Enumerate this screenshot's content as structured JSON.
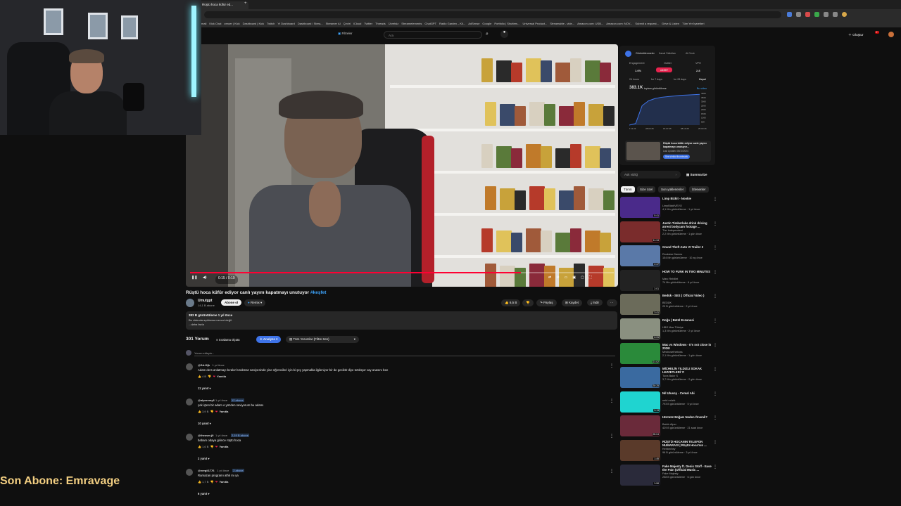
{
  "browser": {
    "tab_title": "Rüştü hoca küfür ed...",
    "new_tab": "+"
  },
  "bookmarks": [
    "mail",
    "Kick Chat",
    "zeroer | Kick",
    "Dashboard | Kick",
    "Twitch",
    "Yt Dashboard",
    "Dashboard / Strea...",
    "Streamer AI",
    "Çeviri",
    "iCloud",
    "Twitter",
    "Threads",
    "Ücretsiz",
    "Streamelements",
    "ChatGPT",
    "Radio Garden – Kli...",
    "AdSense",
    "Google",
    "Portfolio | Shutters...",
    "Universal Product...",
    "Streamable - vide...",
    "Amazon.com: USB...",
    "Amazon.com: NOV...",
    "Submit a request...",
    "Grive & Listen",
    "Tüm Yer İşaretleri"
  ],
  "youtube": {
    "filters": "Filtreler",
    "search_placeholder": "Ara",
    "create": "Oluştur",
    "notif_count": "9+"
  },
  "video": {
    "time": "0:15 / 0:19",
    "progress": 0.78,
    "title": "Rüştü hoca küfür ediyor canlı yayını kapatmayı unutuyor",
    "hashtag": "#keşfet"
  },
  "channel": {
    "name": "Umutgpt",
    "subs": "14,1 B abone",
    "subscribe": "Abone ol",
    "remix": "Remix"
  },
  "actions": {
    "likes": "6,5 B",
    "share": "Paylaş",
    "save": "Kaydet",
    "download": "İndir"
  },
  "description": {
    "stats": "383 B görüntüleme  1 yıl önce",
    "line": "Bu videoda açıklama mevcut değil.",
    "more": "...daha fazla"
  },
  "comments_header": {
    "count": "301 Yorum",
    "sort": "Sıralama ölçütü",
    "analyze": "Analyze",
    "filter": "Tüm Yorumlar (Filtre Ses)",
    "add": "Yorum ekleyin..."
  },
  "comments": [
    {
      "user": "@Sd-f2jk",
      "time": "1 yıl önce",
      "text": "Adam ders anlatmayı bırakır bırakmaz saniyesinde yine öğrencileri için bi şey yapmakla ilgileniyor bir de geciktir diye üzülüyor vay anasını bee",
      "likes": "4 B",
      "reply": "Yanıtla",
      "replies": "11 yanıt"
    },
    {
      "user": "@alperemy6",
      "time": "1 yıl önce",
      "badge": "12 abone",
      "text": "çok içten bir adam o yüzden seviyorum bu adamı",
      "likes": "3,9 B",
      "reply": "Yanıtla",
      "replies": "10 yanıt"
    },
    {
      "user": "@theown.j9",
      "time": "1 yıl önce",
      "badge": "2,19 B abone",
      "text": "babam odaya girince rüştü hoca",
      "likes": "1,6 B",
      "reply": "Yanıtla",
      "replies": "2 yanıt"
    },
    {
      "user": "@vergil1776",
      "time": "1 yıl önce",
      "badge": "2 abone",
      "text": "Ramazan programı athk mı ya",
      "likes": "1,7 B",
      "reply": "Yanıtla",
      "replies": "6 yanıt"
    }
  ],
  "stats_panel": {
    "tabs": [
      "Görüntülenmeler",
      "Kanal Sıklıkları",
      "AI Cevir"
    ],
    "metrics": [
      {
        "label": "Engagement",
        "value": "1.6%"
      },
      {
        "label": "Outlier",
        "value": "x100+"
      },
      {
        "label": "VPH",
        "value": "2.8"
      }
    ],
    "ranges": [
      "24 hours",
      "for 7 days",
      "for 28 days",
      "Hepsi"
    ],
    "views": "383.1K",
    "views_label": "toplam görüntüleme",
    "this_video": "Bu video",
    "yticks": [
      "400K",
      "350K",
      "300K",
      "250K",
      "200K",
      "150K",
      "100K",
      "50K"
    ],
    "xticks": [
      "07.11.24",
      "28.03.25",
      "15.07.25",
      "08.10.25",
      "25.03.26"
    ],
    "growth": [
      0,
      5,
      60,
      75,
      82,
      86,
      88,
      90,
      92,
      93,
      94,
      95
    ],
    "card_title": "Rüştü hoca küfür ediyor canlı yayını kapatmayı unutuyor...",
    "card_sub": "Last Updated 05/10/2024",
    "card_btn": "See similar thumbnails"
  },
  "ask": {
    "placeholder": "Ask vidIQ",
    "summarize": "Summarize"
  },
  "chips": [
    "Tümü",
    "Size özel",
    "Son yüklenenler",
    "İzlenenler"
  ],
  "recs": [
    {
      "title": "Limp Bizkit - Nookie",
      "ch": "LimpBizkitVEVO",
      "meta": "4,1 Mn görüntüleme · 1 yıl önce",
      "dur": "5:41",
      "color": "#4a2a8a"
    },
    {
      "title": "Justin Timberlake drink driving arrest bodycam footage ...",
      "ch": "The Independent",
      "meta": "2,2 Mn görüntüleme · 1 gün önce",
      "dur": "11:34",
      "color": "#7a2c2c"
    },
    {
      "title": "Grand Theft Auto VI Trailer 2",
      "ch": "Rockstar Games",
      "meta": "154 Mn görüntüleme · 10 ay önce",
      "dur": "2:47",
      "color": "#5a79a8"
    },
    {
      "title": "HOW TO FUNK IN TWO MINUTES",
      "ch": "Marc Rebillet",
      "meta": "74 Mn görüntüleme · 6 yıl önce",
      "dur": "2:01",
      "color": "#222"
    },
    {
      "title": "Bedük - SES ( Official Video )",
      "ch": "BEDÜK",
      "meta": "29 B görüntüleme · 2 yıl önce",
      "dur": "3:41",
      "color": "#6b6b5a"
    },
    {
      "title": "Doğu | Betül Eczanesi",
      "ch": "HBO Max Türkiye",
      "meta": "1,3 Mn görüntüleme · 2 yıl önce",
      "dur": "0:31",
      "color": "#8a9080"
    },
    {
      "title": "Mac vs Windows - It's not close in 2026!",
      "ch": "Mrwhosetheboss",
      "meta": "2,1 Mn görüntüleme · 1 gün önce",
      "dur": "21:02",
      "color": "#2a8a3a"
    },
    {
      "title": "MİCHELİN YILDIZLI SOKAK LEZZETLERİ ?!",
      "ch": "Tuna Bakır S",
      "meta": "3,7 Mn görüntüleme · 2 gün önce",
      "dur": "30:25",
      "color": "#3a6aa0"
    },
    {
      "title": "Nil Ulusoy - Cemal Abi",
      "ch": "netd müzik",
      "meta": "793 B görüntüleme · 5 yıl önce",
      "dur": "3:13",
      "color": "#1fd4d0"
    },
    {
      "title": "Hürmüz Boğazı Neden Önemli?",
      "ch": "Babür Alper",
      "meta": "429 B görüntüleme · 21 saat önce",
      "dur": "28:04",
      "color": "#6a2a3a"
    },
    {
      "title": "RÜŞTÜ HOCANIN TELEFON NUMARASI | Rüştü Hoca'nın ...",
      "ch": "Rehberbey",
      "meta": "96 B görüntüleme · 3 yıl önce",
      "dur": "1:49",
      "color": "#5a3a2a"
    },
    {
      "title": "Fake Majesty ft. Denis Stoff - Ease the Pain (Official Music ...",
      "ch": "Fake Majesty",
      "meta": "258 B görüntüleme · 6 gün önce",
      "dur": "3:58",
      "color": "#2a2a3a"
    }
  ],
  "overlay": {
    "text": "Son Abone: Emravage"
  }
}
